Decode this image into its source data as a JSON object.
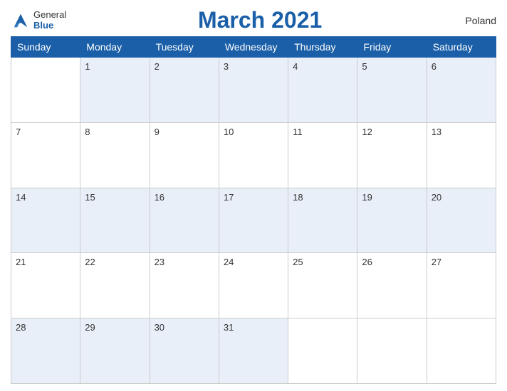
{
  "header": {
    "title": "March 2021",
    "country": "Poland",
    "logo": {
      "general": "General",
      "blue": "Blue"
    }
  },
  "days_of_week": [
    "Sunday",
    "Monday",
    "Tuesday",
    "Wednesday",
    "Thursday",
    "Friday",
    "Saturday"
  ],
  "weeks": [
    [
      null,
      1,
      2,
      3,
      4,
      5,
      6
    ],
    [
      7,
      8,
      9,
      10,
      11,
      12,
      13
    ],
    [
      14,
      15,
      16,
      17,
      18,
      19,
      20
    ],
    [
      21,
      22,
      23,
      24,
      25,
      26,
      27
    ],
    [
      28,
      29,
      30,
      31,
      null,
      null,
      null
    ]
  ]
}
